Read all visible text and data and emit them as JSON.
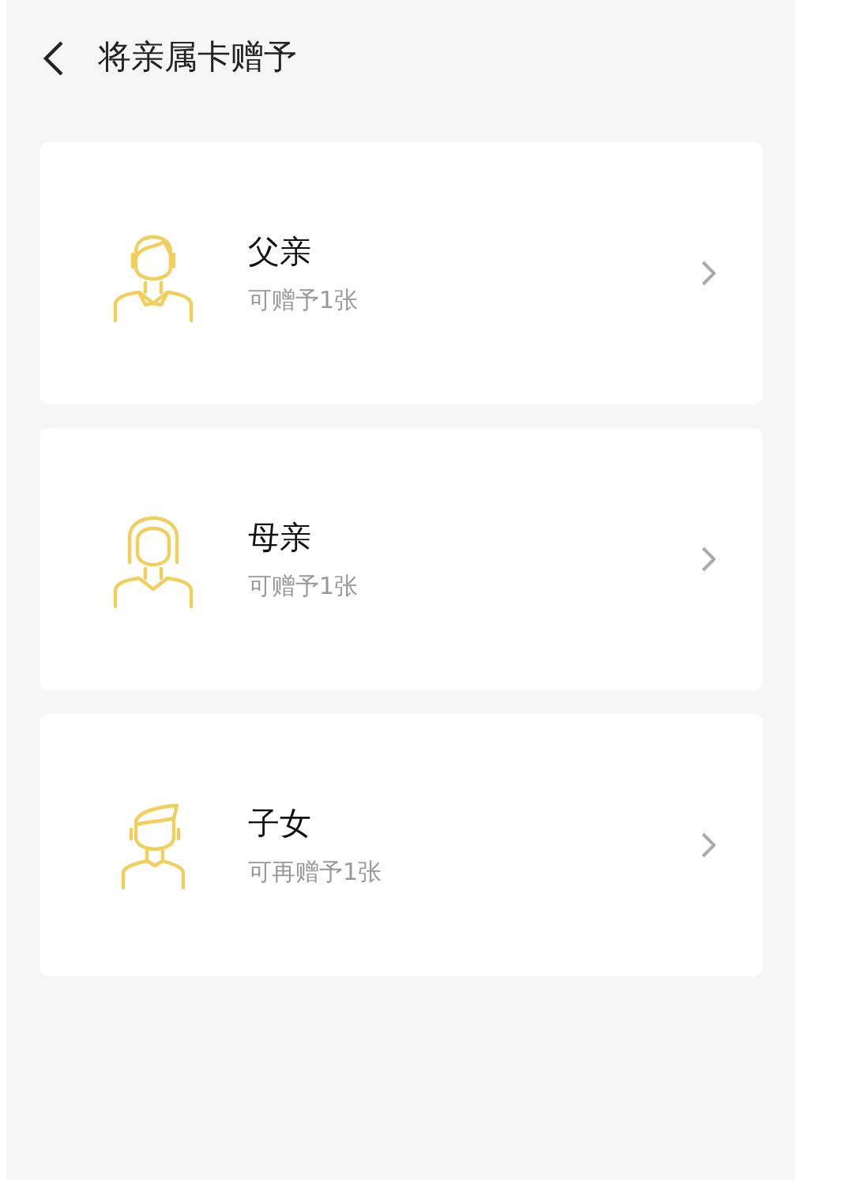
{
  "header": {
    "title": "将亲属卡赠予"
  },
  "members": [
    {
      "kind": "father",
      "name": "父亲",
      "note": "可赠予1张"
    },
    {
      "kind": "mother",
      "name": "母亲",
      "note": "可赠予1张"
    },
    {
      "kind": "child",
      "name": "子女",
      "note": "可再赠予1张"
    }
  ]
}
